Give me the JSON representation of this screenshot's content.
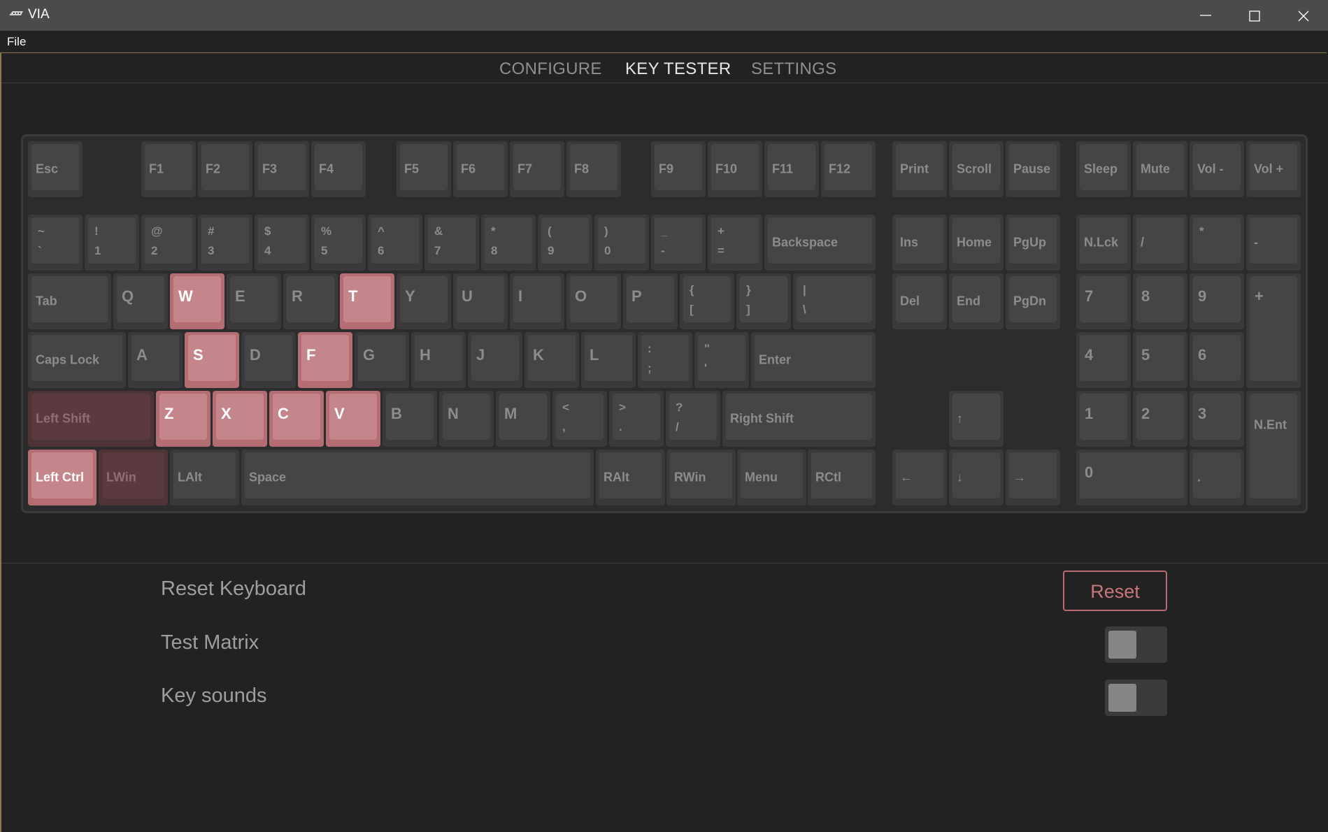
{
  "window": {
    "title": "VIA",
    "controls": [
      "minimize",
      "maximize",
      "close"
    ]
  },
  "menu": {
    "file": "File"
  },
  "tabs": [
    {
      "label": "CONFIGURE",
      "active": false
    },
    {
      "label": "KEY TESTER",
      "active": true
    },
    {
      "label": "SETTINGS",
      "active": false
    }
  ],
  "colors": {
    "pressed": "#c4858b",
    "held": "#5a3a3e",
    "accent": "#c9757d"
  },
  "keys": {
    "esc": "Esc",
    "f1": "F1",
    "f2": "F2",
    "f3": "F3",
    "f4": "F4",
    "f5": "F5",
    "f6": "F6",
    "f7": "F7",
    "f8": "F8",
    "f9": "F9",
    "f10": "F10",
    "f11": "F11",
    "f12": "F12",
    "print": "Print",
    "scroll": "Scroll",
    "pause": "Pause",
    "sleep": "Sleep",
    "mute": "Mute",
    "vol_down": "Vol -",
    "vol_up": "Vol +",
    "tilde_shift": "~",
    "tilde": "`",
    "n1_shift": "!",
    "n1": "1",
    "n2_shift": "@",
    "n2": "2",
    "n3_shift": "#",
    "n3": "3",
    "n4_shift": "$",
    "n4": "4",
    "n5_shift": "%",
    "n5": "5",
    "n6_shift": "^",
    "n6": "6",
    "n7_shift": "&",
    "n7": "7",
    "n8_shift": "*",
    "n8": "8",
    "n9_shift": "(",
    "n9": "9",
    "n0_shift": ")",
    "n0": "0",
    "minus_shift": "_",
    "minus": "-",
    "equals_shift": "+",
    "equals": "=",
    "backspace": "Backspace",
    "ins": "Ins",
    "home": "Home",
    "pgup": "PgUp",
    "nlck": "N.Lck",
    "kp_slash": "/",
    "kp_star": "*",
    "kp_minus": "-",
    "tab": "Tab",
    "q": "Q",
    "w": "W",
    "e": "E",
    "r": "R",
    "t": "T",
    "y": "Y",
    "u": "U",
    "i": "I",
    "o": "O",
    "p": "P",
    "lbracket_shift": "{",
    "lbracket": "[",
    "rbracket_shift": "}",
    "rbracket": "]",
    "backslash_shift": "|",
    "backslash": "\\",
    "del": "Del",
    "end": "End",
    "pgdn": "PgDn",
    "kp7": "7",
    "kp8": "8",
    "kp9": "9",
    "kp_plus": "+",
    "caps": "Caps Lock",
    "a": "A",
    "s": "S",
    "d": "D",
    "f": "F",
    "g": "G",
    "h": "H",
    "j": "J",
    "k": "K",
    "l": "L",
    "semicolon_shift": ":",
    "semicolon": ";",
    "quote_shift": "\"",
    "quote": "'",
    "enter": "Enter",
    "kp4": "4",
    "kp5": "5",
    "kp6": "6",
    "lshift": "Left Shift",
    "z": "Z",
    "x": "X",
    "c": "C",
    "v": "V",
    "b": "B",
    "n": "N",
    "m": "M",
    "comma_shift": "<",
    "comma": ",",
    "period_shift": ">",
    "period": ".",
    "slash_shift": "?",
    "slash": "/",
    "rshift": "Right Shift",
    "up": "↑",
    "kp1": "1",
    "kp2": "2",
    "kp3": "3",
    "kp_enter": "N.Ent",
    "lctrl": "Left Ctrl",
    "lwin": "LWin",
    "lalt": "LAlt",
    "space": "Space",
    "ralt": "RAlt",
    "rwin": "RWin",
    "menu": "Menu",
    "rctl": "RCtl",
    "left": "←",
    "down": "↓",
    "right": "→",
    "kp0": "0",
    "kp_dot": "."
  },
  "pressed_keys": [
    "W",
    "T",
    "S",
    "F",
    "Z",
    "X",
    "C",
    "V",
    "Left Ctrl"
  ],
  "held_keys": [
    "Left Shift",
    "LWin"
  ],
  "settings": {
    "reset_label": "Reset Keyboard",
    "reset_button": "Reset",
    "test_matrix_label": "Test Matrix",
    "test_matrix_on": false,
    "key_sounds_label": "Key sounds",
    "key_sounds_on": false
  }
}
